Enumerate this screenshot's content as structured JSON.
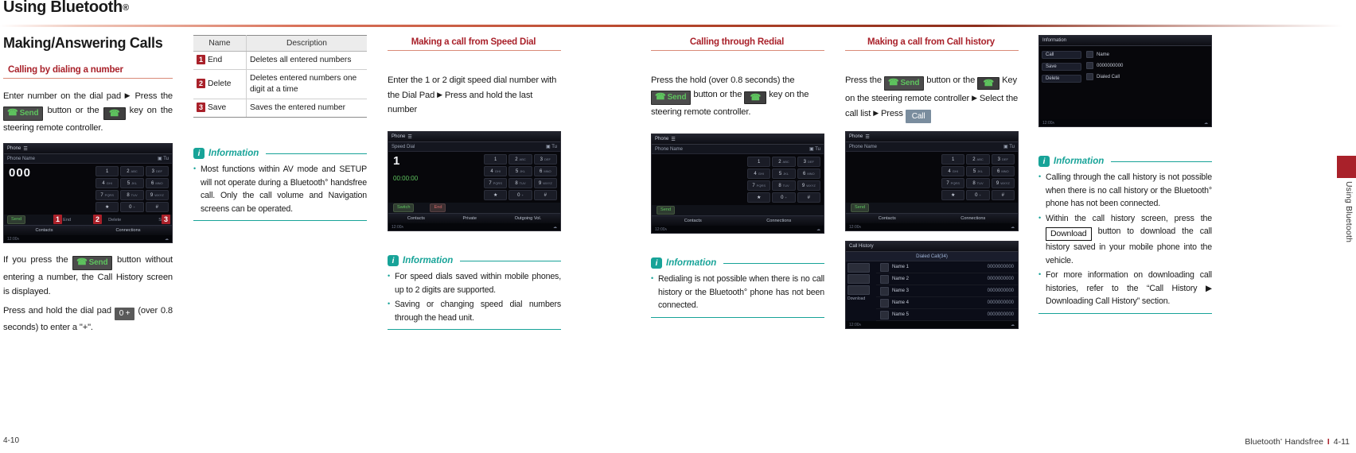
{
  "header": {
    "title": "Using Bluetooth",
    "registered_mark": "®"
  },
  "column1": {
    "section_title": "Making/Answering Calls",
    "subhead": "Calling by dialing a number",
    "para1_a": "Enter number on the dial pad",
    "para1_arrow": "▶",
    "para1_b": "Press the",
    "send_chip": "Send",
    "para1_c": "button or the",
    "para1_d": "key on the steering remote controller.",
    "para2_a": "If you press the",
    "para2_b": "button without entering a number, the Call History screen is displayed.",
    "para2_c": "Press and hold the dial pad",
    "zero_chip": "0 +",
    "para2_d": "(over 0.8 seconds) to enter a \"+\".",
    "screenshot": {
      "title": "Phone",
      "name_label": "Phone Name",
      "signal": "▣ Tu",
      "number": "000",
      "keys": [
        {
          "d": "1",
          "s": ""
        },
        {
          "d": "2",
          "s": "ABC"
        },
        {
          "d": "3",
          "s": "DEF"
        },
        {
          "d": "4",
          "s": "GHI"
        },
        {
          "d": "5",
          "s": "JKL"
        },
        {
          "d": "6",
          "s": "MNO"
        },
        {
          "d": "7",
          "s": "PQRS"
        },
        {
          "d": "8",
          "s": "TUV"
        },
        {
          "d": "9",
          "s": "WXYZ"
        },
        {
          "d": "★",
          "s": ""
        },
        {
          "d": "0",
          "s": "+"
        },
        {
          "d": "#",
          "s": ""
        }
      ],
      "send": "Send",
      "end": "End",
      "delete": "Delete",
      "save": "Save",
      "contacts": "Contacts",
      "connections": "Connections",
      "time": "12:00ᴀ",
      "callouts": [
        "1",
        "2",
        "3"
      ]
    }
  },
  "column2": {
    "table": {
      "headers": [
        "Name",
        "Description"
      ],
      "rows": [
        {
          "num": "1",
          "name": "End",
          "desc": "Deletes all entered numbers"
        },
        {
          "num": "2",
          "name": "Delete",
          "desc": "Deletes entered numbers one digit at a time"
        },
        {
          "num": "3",
          "name": "Save",
          "desc": "Saves the entered number"
        }
      ]
    },
    "information": {
      "label": "Information",
      "items": [
        "Most functions within AV mode and SETUP will not operate during a Bluetooth° handsfree call. Only the call volume and Navigation screens can be operated."
      ]
    }
  },
  "column3": {
    "subhead": "Making a call from Speed Dial",
    "para_a": "Enter the 1 or 2 digit speed dial number with the Dial Pad",
    "arrow": "▶",
    "para_b": "Press and hold the last number",
    "screenshot": {
      "title": "Phone",
      "row_label": "Speed Dial",
      "signal": "▣ Tu",
      "number": "1",
      "timer": "00:00:00",
      "switch": "Switch",
      "end": "End",
      "contacts": "Contacts",
      "private": "Private",
      "outgoing": "Outgoing Vol.",
      "time": "12:00ᴀ",
      "keys": [
        {
          "d": "1",
          "s": ""
        },
        {
          "d": "2",
          "s": "ABC"
        },
        {
          "d": "3",
          "s": "DEF"
        },
        {
          "d": "4",
          "s": "GHI"
        },
        {
          "d": "5",
          "s": "JKL"
        },
        {
          "d": "6",
          "s": "MNO"
        },
        {
          "d": "7",
          "s": "PQRS"
        },
        {
          "d": "8",
          "s": "TUV"
        },
        {
          "d": "9",
          "s": "WXYZ"
        },
        {
          "d": "★",
          "s": ""
        },
        {
          "d": "0",
          "s": "+"
        },
        {
          "d": "#",
          "s": ""
        }
      ]
    },
    "information": {
      "label": "Information",
      "items": [
        "For speed dials saved within mobile phones, up to 2 digits are supported.",
        "Saving or changing speed dial numbers through the head unit."
      ]
    }
  },
  "column4": {
    "subhead": "Calling through Redial",
    "para_a": "Press the hold (over 0.8 seconds) the",
    "send_chip": "Send",
    "para_b": "button or the",
    "para_c": "key on the steering remote controller.",
    "screenshot": {
      "title": "Phone",
      "name_label": "Phone Name",
      "signal": "▣ Tu",
      "send": "Send",
      "contacts": "Contacts",
      "connections": "Connections",
      "time": "12:00ᴀ",
      "keys": [
        {
          "d": "1",
          "s": ""
        },
        {
          "d": "2",
          "s": "ABC"
        },
        {
          "d": "3",
          "s": "DEF"
        },
        {
          "d": "4",
          "s": "GHI"
        },
        {
          "d": "5",
          "s": "JKL"
        },
        {
          "d": "6",
          "s": "MNO"
        },
        {
          "d": "7",
          "s": "PQRS"
        },
        {
          "d": "8",
          "s": "TUV"
        },
        {
          "d": "9",
          "s": "WXYZ"
        },
        {
          "d": "★",
          "s": ""
        },
        {
          "d": "0",
          "s": "+"
        },
        {
          "d": "#",
          "s": ""
        }
      ]
    },
    "information": {
      "label": "Information",
      "items": [
        "Redialing is not possible when there is no call history or the Bluetooth° phone has not been connected."
      ]
    }
  },
  "column5": {
    "subhead": "Making a call from Call history",
    "para_a": "Press the",
    "send_chip": "Send",
    "para_b": "button or the",
    "para_c": "Key on the steering remote controller",
    "arrow": "▶",
    "para_d": "Select the call list",
    "para_e": "Press",
    "call_chip": "Call",
    "screenshot": {
      "title": "Phone",
      "name_label": "Phone Name",
      "signal": "▣ Tu",
      "send": "Send",
      "contacts": "Contacts",
      "connections": "Connections",
      "time": "12:00ᴀ",
      "keys": [
        {
          "d": "1",
          "s": ""
        },
        {
          "d": "2",
          "s": "ABC"
        },
        {
          "d": "3",
          "s": "DEF"
        },
        {
          "d": "4",
          "s": "GHI"
        },
        {
          "d": "5",
          "s": "JKL"
        },
        {
          "d": "6",
          "s": "MNO"
        },
        {
          "d": "7",
          "s": "PQRS"
        },
        {
          "d": "8",
          "s": "TUV"
        },
        {
          "d": "9",
          "s": "WXYZ"
        },
        {
          "d": "★",
          "s": ""
        },
        {
          "d": "0",
          "s": "+"
        },
        {
          "d": "#",
          "s": ""
        }
      ]
    },
    "screenshot2": {
      "title": "Call History",
      "tab": "Dialed Call(34)",
      "download": "Download",
      "rows": [
        {
          "name": "Name 1",
          "num": "0000000000"
        },
        {
          "name": "Name 2",
          "num": "0000000000"
        },
        {
          "name": "Name 3",
          "num": "0000000000"
        },
        {
          "name": "Name 4",
          "num": "0000000000"
        },
        {
          "name": "Name 5",
          "num": "0000000000"
        }
      ],
      "time": "12:00ᴀ"
    }
  },
  "column6": {
    "screenshot": {
      "title": "Information",
      "rows": [
        {
          "label": "Call",
          "icon": "person-icon",
          "value": "Name"
        },
        {
          "label": "Save",
          "icon": "number-icon",
          "value": "0000000000"
        },
        {
          "label": "Delete",
          "icon": "phone-icon",
          "value": "Dialed Call"
        }
      ],
      "time": "12:00ᴀ"
    },
    "information": {
      "label": "Information",
      "items": [
        "Calling through the call history is not possible when there is no call history or the Bluetooth° phone has not been connected.",
        "Within the call history screen, press the Download button to download the call history saved in your mobile phone into the vehicle.",
        "For more information on downloading call histories, refer to the “Call History ▶ Downloading Call History” section."
      ],
      "download_chip": "Download"
    }
  },
  "side_tab_label": "Using Bluetooth",
  "footer": {
    "left": "4-10",
    "right_text": "Bluetooth",
    "right_reg": "°",
    "right_text2": "Handsfree",
    "right_bar": "I",
    "right_page": "4-11"
  },
  "colors": {
    "accent_red": "#a9212a",
    "info_teal": "#17a398",
    "rule": "#d98a78"
  }
}
